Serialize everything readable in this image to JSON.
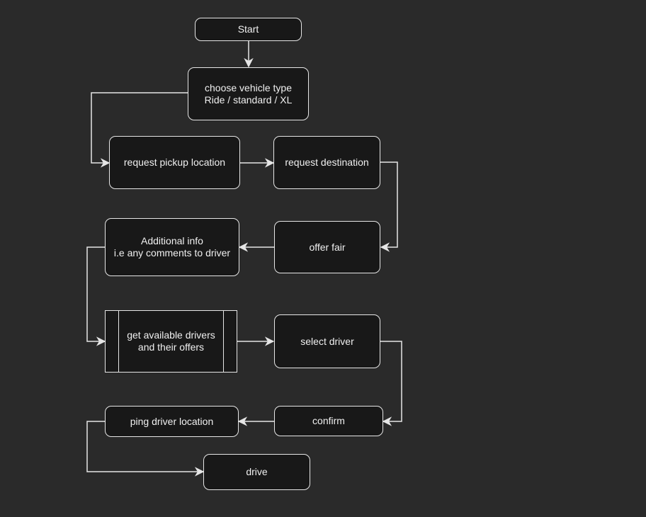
{
  "diagram": {
    "background": "#2a2a2a",
    "stroke_color": "#e6e6e6",
    "nodes": {
      "start": "Start",
      "vehicle": "choose vehicle type\nRide / standard / XL",
      "pickup": "request pickup location",
      "destination": "request destination",
      "fare": "offer fair",
      "additional": "Additional info\ni.e any comments to driver",
      "drivers": "get available drivers\nand their offers",
      "select": "select driver",
      "confirm": "confirm",
      "ping": "ping driver location",
      "drive": "drive"
    },
    "edges": [
      {
        "from": "start",
        "to": "vehicle"
      },
      {
        "from": "vehicle",
        "to": "pickup"
      },
      {
        "from": "pickup",
        "to": "destination"
      },
      {
        "from": "destination",
        "to": "fare"
      },
      {
        "from": "fare",
        "to": "additional"
      },
      {
        "from": "additional",
        "to": "drivers"
      },
      {
        "from": "drivers",
        "to": "select"
      },
      {
        "from": "select",
        "to": "confirm"
      },
      {
        "from": "confirm",
        "to": "ping"
      },
      {
        "from": "ping",
        "to": "drive"
      }
    ]
  }
}
